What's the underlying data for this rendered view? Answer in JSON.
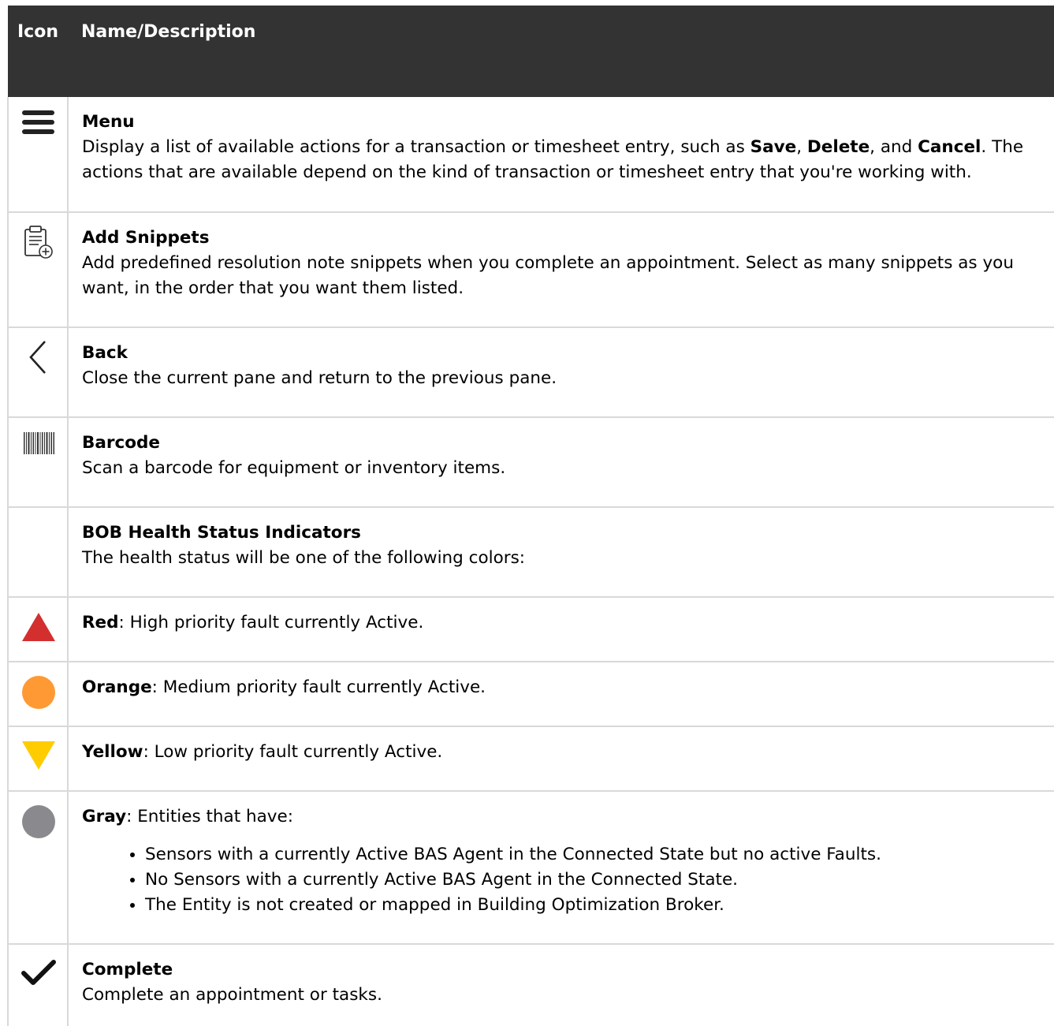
{
  "header": {
    "icon_col": "Icon",
    "desc_col": "Name/Description"
  },
  "rows": {
    "menu": {
      "icon": "menu-icon",
      "title": "Menu",
      "text_before": "Display a list of available actions for a transaction or timesheet entry, such as ",
      "save": "Save",
      "sep1": ", ",
      "delete": "Delete",
      "sep2": ", and ",
      "cancel": "Cancel",
      "text_after": ". The actions that are available depend on the kind of transaction or timesheet entry that you're working with."
    },
    "snippets": {
      "icon": "clipboard-add-icon",
      "title": "Add Snippets",
      "text": "Add predefined resolution note snippets when you complete an appointment. Select as many snippets as you want, in the order that you want them listed."
    },
    "back": {
      "icon": "chevron-left-icon",
      "title": "Back",
      "text": "Close the current pane and return to the previous pane."
    },
    "barcode": {
      "icon": "barcode-icon",
      "title": "Barcode",
      "text": "Scan a barcode for equipment or inventory items."
    },
    "health": {
      "title": "BOB Health Status Indicators",
      "text": "The health status will be one of the following colors:"
    },
    "red": {
      "icon": "red-triangle-icon",
      "color": "#d32f2f",
      "label": "Red",
      "text": ": High priority fault currently Active."
    },
    "orange": {
      "icon": "orange-circle-icon",
      "color": "#ff9933",
      "label": "Orange",
      "text": ": Medium priority fault currently Active."
    },
    "yellow": {
      "icon": "yellow-triangle-down-icon",
      "color": "#ffcc00",
      "label": "Yellow",
      "text": ": Low priority fault currently Active."
    },
    "gray": {
      "icon": "gray-circle-icon",
      "color": "#8a8a8e",
      "label": "Gray",
      "text": ": Entities that have:",
      "bullets": [
        "Sensors with a currently Active BAS Agent in the Connected State but no active Faults.",
        "No Sensors with a currently Active BAS Agent in the Connected State.",
        "The Entity is not created or mapped in Building Optimization Broker."
      ]
    },
    "complete": {
      "icon": "checkmark-icon",
      "title": "Complete",
      "text": "Complete an appointment or tasks."
    }
  }
}
